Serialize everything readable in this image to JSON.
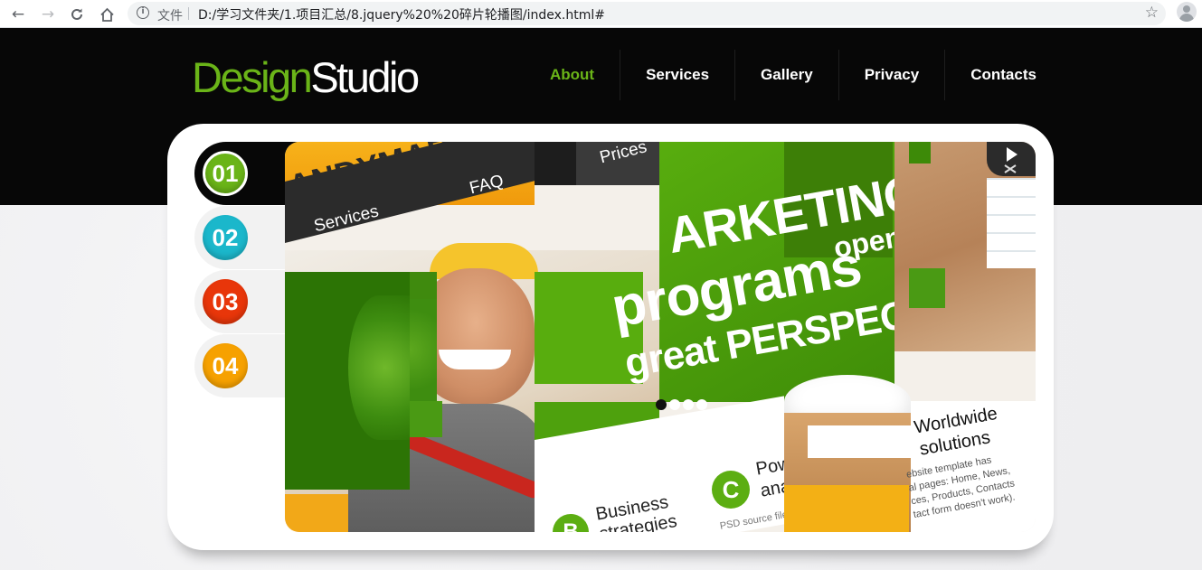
{
  "browser": {
    "back_icon": "arrow-back-icon",
    "forward_icon": "arrow-forward-icon",
    "reload_icon": "reload-icon",
    "home_icon": "home-icon",
    "scheme_label": "文件",
    "url": "D:/学习文件夹/1.项目汇总/8.jquery%20%20碎片轮播图/index.html#",
    "bookmark_icon": "star-icon",
    "profile_icon": "account-icon"
  },
  "header": {
    "logo_part1": "Design",
    "logo_part2": "Studio",
    "logo_colors": {
      "design": "#6ab418",
      "studio": "#ffffff"
    },
    "menu": [
      {
        "label": "About",
        "active": true
      },
      {
        "label": "Services",
        "active": false
      },
      {
        "label": "Gallery",
        "active": false
      },
      {
        "label": "Privacy",
        "active": false
      },
      {
        "label": "Contacts",
        "active": false
      }
    ]
  },
  "slider": {
    "tabs": [
      {
        "label": "01",
        "color": "#6ab418",
        "active": true
      },
      {
        "label": "02",
        "color": "#1bb7cb",
        "active": false
      },
      {
        "label": "03",
        "color": "#e8360a",
        "active": false
      },
      {
        "label": "04",
        "color": "#f6a100",
        "active": false
      }
    ],
    "slide_text": {
      "brand": "ANDYMAR",
      "nav_services": "Services",
      "nav_faq": "FAQ",
      "nav_prices": "Prices",
      "marketing": "ARKETING",
      "programs": "programs",
      "open": "open",
      "great": "great PERSPECTIVE",
      "worldwide": "Worldwide",
      "solutions": "solutions",
      "body_text": "ebsite template has\nal pages: Home, News,\nces, Products, Contacts\ntact form doesn't work).",
      "business": "Business",
      "strategies": "strategies",
      "pow": "Pow",
      "ana": "ana",
      "badge_c": "C",
      "badge_b": "B",
      "psd": "PSD source file"
    },
    "pager": {
      "count": 4,
      "active_index": 0
    },
    "close_icon": "close-icon"
  }
}
